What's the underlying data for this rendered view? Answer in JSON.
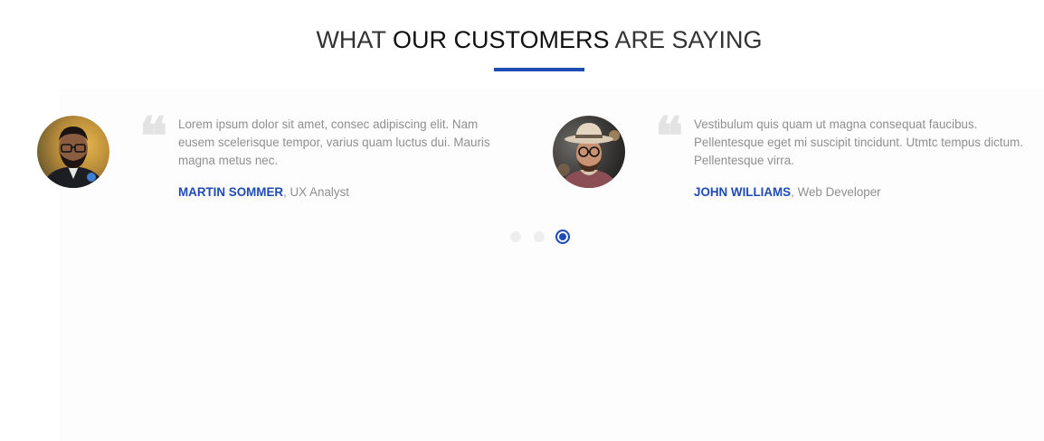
{
  "section": {
    "title_light_1": "WHAT ",
    "title_bold": "OUR CUSTOMERS",
    "title_light_2": " ARE SAYING"
  },
  "testimonials": [
    {
      "quote": "Lorem ipsum dolor sit amet, consec adipiscing elit. Nam eusem scelerisque tempor, varius quam luctus dui. Mauris magna metus nec.",
      "name": "MARTIN SOMMER",
      "separator": ", ",
      "role": "UX Analyst",
      "avatar": "man-with-glasses-and-beard-photo"
    },
    {
      "quote": "Vestibulum quis quam ut magna consequat faucibus. Pellentesque eget mi suscipit tincidunt. Utmtc tempus dictum. Pellentesque virra.",
      "name": "JOHN WILLIAMS",
      "separator": ", ",
      "role": "Web Developer",
      "avatar": "man-with-hat-and-glasses-photo"
    }
  ],
  "quote_glyph": "❝",
  "pagination": {
    "pages": 3,
    "active": 3
  },
  "colors": {
    "accent": "#1f4bb5",
    "text_muted": "#8f8f8f",
    "quote_mark": "#e3e3e3",
    "dot_inactive": "#eeeeee"
  }
}
